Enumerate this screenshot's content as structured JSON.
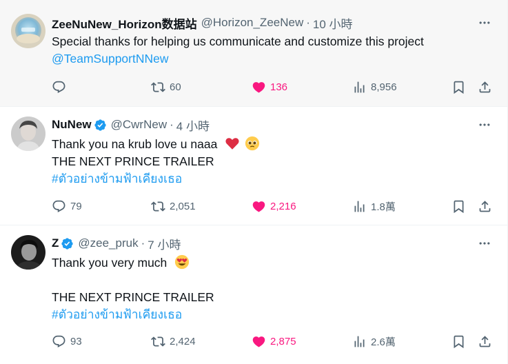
{
  "tweets": [
    {
      "name": "ZeeNuNew_Horizon数据站",
      "handle": "@Horizon_ZeeNew",
      "separator": "·",
      "time": "10 小時",
      "verified": false,
      "lines": [
        "Special thanks for helping us communicate and customize this project"
      ],
      "link": "@TeamSupportNNew",
      "replies": "",
      "retweets": "60",
      "likes": "136",
      "views": "8,956"
    },
    {
      "name": "NuNew",
      "handle": "@CwrNew",
      "separator": "·",
      "time": "4 小時",
      "verified": true,
      "lines": [
        "Thank you na krub love u naaa",
        "THE NEXT PRINCE TRAILER"
      ],
      "hashtag": "#ตัวอย่างข้ามฟ้าเคียงเธอ",
      "replies": "79",
      "retweets": "2,051",
      "likes": "2,216",
      "views": "1.8萬"
    },
    {
      "name": "Z",
      "handle": "@zee_pruk",
      "separator": "·",
      "time": "7 小時",
      "verified": true,
      "lines": [
        "Thank you very much",
        "THE NEXT PRINCE TRAILER"
      ],
      "hashtag": "#ตัวอย่างข้ามฟ้าเคียงเธอ",
      "replies": "93",
      "retweets": "2,424",
      "likes": "2,875",
      "views": "2.6萬"
    }
  ],
  "icons": {
    "reply": "reply-icon",
    "retweet": "retweet-icon",
    "like": "heart-icon",
    "views": "views-icon",
    "bookmark": "bookmark-icon",
    "share": "share-icon",
    "more": "more-icon",
    "verified": "verified-badge-icon"
  },
  "colors": {
    "link": "#1d9bf0",
    "like_active": "#f91880",
    "muted": "#536471",
    "highlight_bg": "#f7f7f7"
  }
}
